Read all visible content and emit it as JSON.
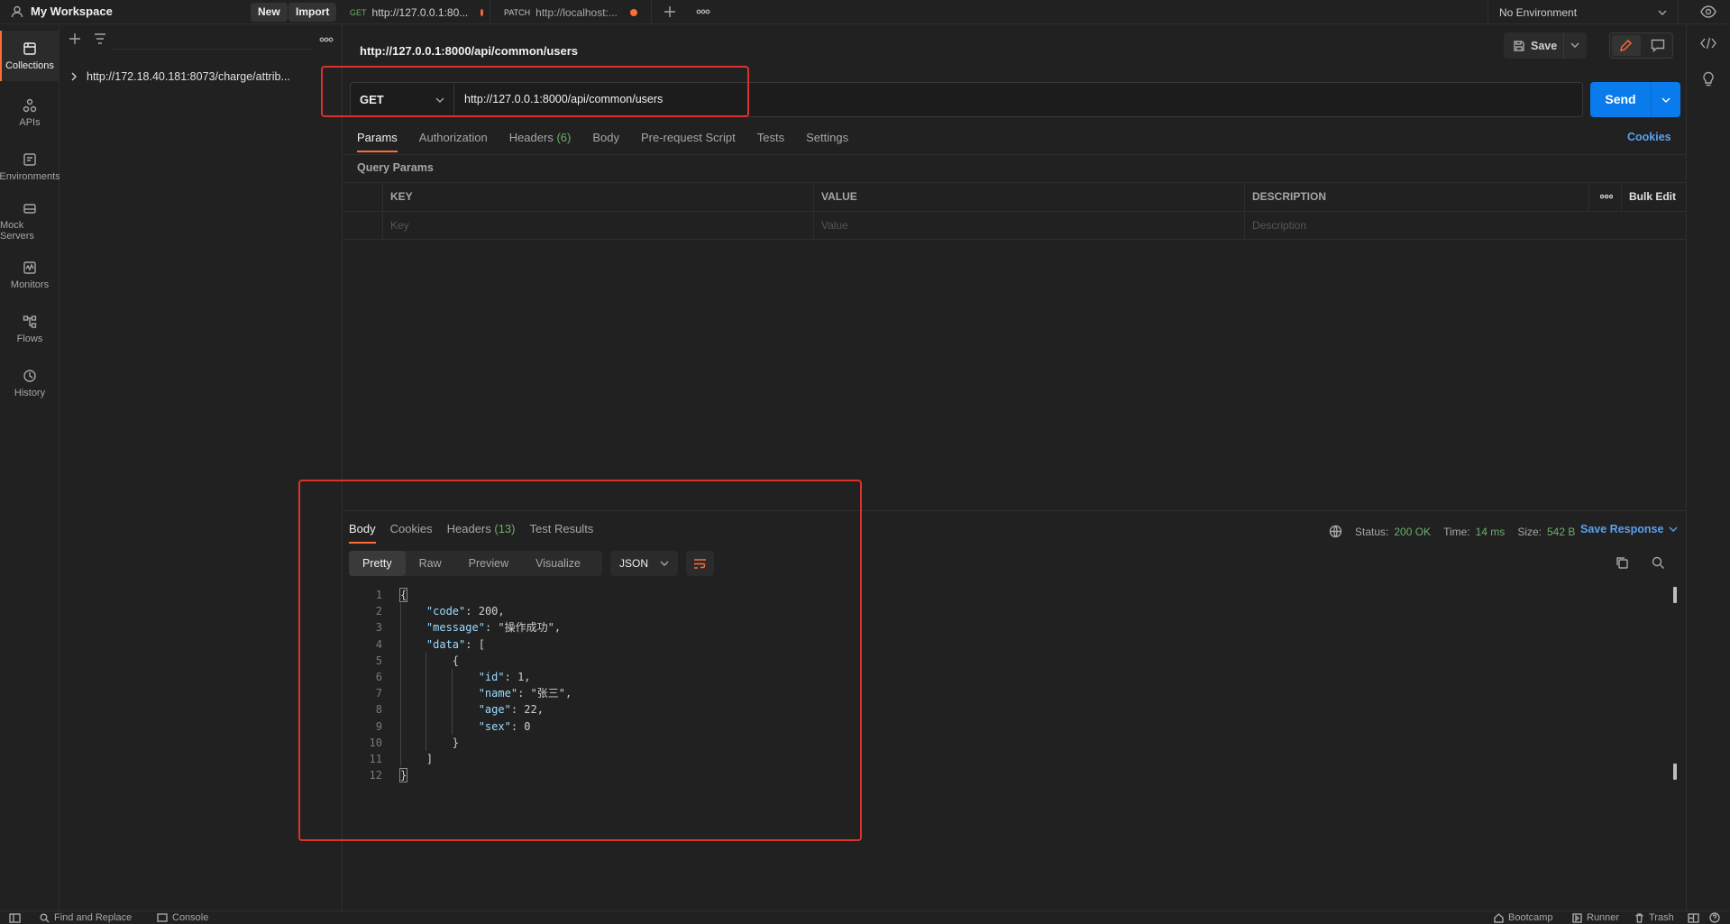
{
  "topbar": {
    "workspace": "My Workspace",
    "new_label": "New",
    "import_label": "Import",
    "tabs": [
      {
        "method": "GET",
        "title": "http://127.0.0.1:80...",
        "method_color": "#6bb06b"
      },
      {
        "method": "PATCH",
        "title": "http://localhost:...",
        "method_color": "#c9c9c9"
      }
    ],
    "environment": "No Environment"
  },
  "rail": {
    "items": [
      {
        "label": "Collections",
        "icon": "collections-icon"
      },
      {
        "label": "APIs",
        "icon": "apis-icon"
      },
      {
        "label": "Environments",
        "icon": "environments-icon"
      },
      {
        "label": "Mock Servers",
        "icon": "mock-servers-icon"
      },
      {
        "label": "Monitors",
        "icon": "monitors-icon"
      },
      {
        "label": "Flows",
        "icon": "flows-icon"
      },
      {
        "label": "History",
        "icon": "history-icon"
      }
    ]
  },
  "sidebar": {
    "collection": "http://172.18.40.181:8073/charge/attrib..."
  },
  "request": {
    "title": "http://127.0.0.1:8000/api/common/users",
    "save_label": "Save",
    "method": "GET",
    "url": "http://127.0.0.1:8000/api/common/users",
    "send_label": "Send",
    "tabs": [
      {
        "label": "Params",
        "count": ""
      },
      {
        "label": "Authorization",
        "count": ""
      },
      {
        "label": "Headers",
        "count": "(6)"
      },
      {
        "label": "Body",
        "count": ""
      },
      {
        "label": "Pre-request Script",
        "count": ""
      },
      {
        "label": "Tests",
        "count": ""
      },
      {
        "label": "Settings",
        "count": ""
      }
    ],
    "cookies_label": "Cookies",
    "query_params_title": "Query Params",
    "columns": {
      "key": "KEY",
      "value": "VALUE",
      "description": "DESCRIPTION",
      "bulk_edit": "Bulk Edit"
    },
    "placeholders": {
      "key": "Key",
      "value": "Value",
      "description": "Description"
    }
  },
  "response": {
    "tabs": [
      {
        "label": "Body",
        "count": ""
      },
      {
        "label": "Cookies",
        "count": ""
      },
      {
        "label": "Headers",
        "count": "(13)"
      },
      {
        "label": "Test Results",
        "count": ""
      }
    ],
    "status_label": "Status:",
    "status_value": "200 OK",
    "time_label": "Time:",
    "time_value": "14 ms",
    "size_label": "Size:",
    "size_value": "542 B",
    "save_response": "Save Response",
    "views": [
      "Pretty",
      "Raw",
      "Preview",
      "Visualize"
    ],
    "format": "JSON",
    "body_lines": [
      "{",
      "    \"code\": 200,",
      "    \"message\": \"操作成功\",",
      "    \"data\": [",
      "        {",
      "            \"id\": 1,",
      "            \"name\": \"张三\",",
      "            \"age\": 22,",
      "            \"sex\": 0",
      "        }",
      "    ]",
      "}"
    ]
  },
  "footer": {
    "find_replace": "Find and Replace",
    "console": "Console",
    "bootcamp": "Bootcamp",
    "runner": "Runner",
    "trash": "Trash"
  },
  "colors": {
    "accent": "#ff6c37",
    "send": "#097bed",
    "success": "#6bb06b",
    "annotation": "#d9332b"
  }
}
